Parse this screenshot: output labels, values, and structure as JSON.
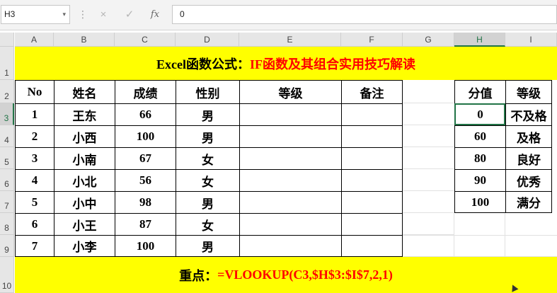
{
  "formula_bar": {
    "name_box": "H3",
    "name_box_arrow": "▾",
    "dots": "⋮",
    "cancel_icon": "×",
    "enter_icon": "✓",
    "function_icon": "fx",
    "formula_value": "0"
  },
  "columns": [
    "A",
    "B",
    "C",
    "D",
    "E",
    "F",
    "G",
    "H",
    "I"
  ],
  "rows": [
    "1",
    "2",
    "3",
    "4",
    "5",
    "6",
    "7",
    "8",
    "9",
    "10"
  ],
  "title": {
    "black_part": "Excel函数公式：",
    "red_part": "IF函数及其组合实用技巧解读"
  },
  "main_table": {
    "headers": [
      "No",
      "姓名",
      "成绩",
      "性别",
      "等级",
      "备注"
    ],
    "rows": [
      [
        "1",
        "王东",
        "66",
        "男",
        "",
        ""
      ],
      [
        "2",
        "小西",
        "100",
        "男",
        "",
        ""
      ],
      [
        "3",
        "小南",
        "67",
        "女",
        "",
        ""
      ],
      [
        "4",
        "小北",
        "56",
        "女",
        "",
        ""
      ],
      [
        "5",
        "小中",
        "98",
        "男",
        "",
        ""
      ],
      [
        "6",
        "小王",
        "87",
        "女",
        "",
        ""
      ],
      [
        "7",
        "小李",
        "100",
        "男",
        "",
        ""
      ]
    ]
  },
  "lookup_table": {
    "headers": [
      "分值",
      "等级"
    ],
    "rows": [
      [
        "0",
        "不及格"
      ],
      [
        "60",
        "及格"
      ],
      [
        "80",
        "良好"
      ],
      [
        "90",
        "优秀"
      ],
      [
        "100",
        "满分"
      ]
    ]
  },
  "footer": {
    "black_part": "重点：",
    "red_part": "=VLOOKUP(C3,$H$3:$I$7,2,1)"
  },
  "selected_cell": "H3",
  "colors": {
    "highlight": "#ffff00",
    "title_red": "#ff0000",
    "selection": "#217346"
  }
}
